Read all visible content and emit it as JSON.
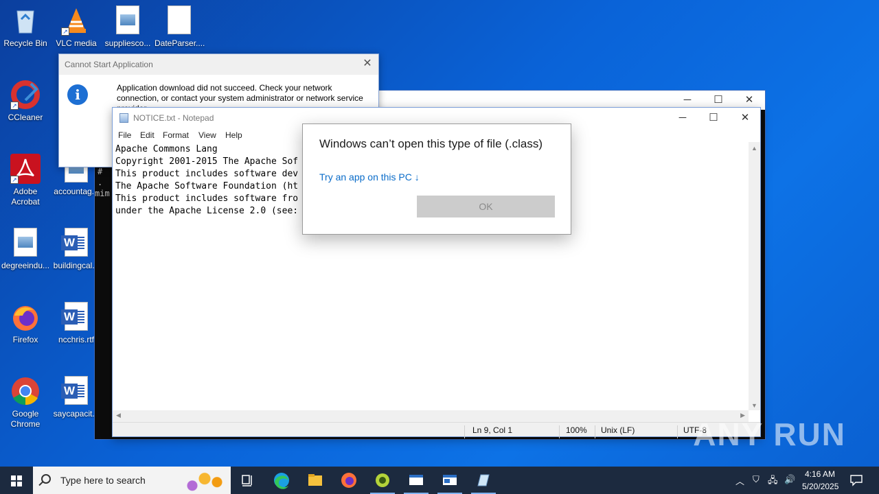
{
  "desktop": {
    "icons": [
      {
        "label": "Recycle Bin",
        "icon": "recycle-bin-icon"
      },
      {
        "label": "VLC media",
        "icon": "vlc-icon"
      },
      {
        "label": "suppliesco...",
        "icon": "image-file-icon"
      },
      {
        "label": "DateParser....",
        "icon": "blank-file-icon"
      },
      {
        "label": "CCleaner",
        "icon": "ccleaner-icon"
      },
      {
        "label": "Adobe Acrobat",
        "icon": "acrobat-icon"
      },
      {
        "label": "accountag...",
        "icon": "image-file-icon"
      },
      {
        "label": "degreeindu...",
        "icon": "image-file-icon"
      },
      {
        "label": "buildingcal...",
        "icon": "word-doc-icon"
      },
      {
        "label": "Firefox",
        "icon": "firefox-icon"
      },
      {
        "label": "ncchris.rtf",
        "icon": "word-doc-icon"
      },
      {
        "label": "Google Chrome",
        "icon": "chrome-icon"
      },
      {
        "label": "saycapacit...",
        "icon": "word-doc-icon"
      }
    ]
  },
  "console": {
    "text_lines": [
      "#",
      ".",
      "mim"
    ]
  },
  "error_dialog": {
    "title": "Cannot Start Application",
    "message": "Application download did not succeed. Check your network connection, or contact your system administrator or network service provider."
  },
  "notepad": {
    "title": "NOTICE.txt - Notepad",
    "menu": [
      "File",
      "Edit",
      "Format",
      "View",
      "Help"
    ],
    "content_lines": [
      "Apache Commons Lang",
      "Copyright 2001-2015 The Apache Sof",
      "",
      "This product includes software dev",
      "The Apache Software Foundation (ht",
      "",
      "This product includes software fro",
      "under the Apache License 2.0 (see: StringUtils.containsWhitespace())"
    ],
    "status": {
      "position": "Ln 9, Col 1",
      "zoom": "100%",
      "line_endings": "Unix (LF)",
      "encoding": "UTF-8"
    }
  },
  "open_with_dialog": {
    "heading": "Windows can’t open this type of file (.class)",
    "link": "Try an app on this PC ↓",
    "ok_label": "OK"
  },
  "watermark": "ANY RUN",
  "taskbar": {
    "search_placeholder": "Type here to search",
    "pinned": [
      "task-view-icon",
      "edge-icon",
      "file-explorer-icon",
      "firefox-icon",
      "app-icon",
      "window-app-icon",
      "window-app-icon",
      "notepad-icon"
    ],
    "time": "4:16 AM",
    "date": "5/20/2025"
  },
  "colors": {
    "desktop_bg": "#0a63d8",
    "taskbar_bg": "#1c2a3f",
    "link": "#0a6cc9",
    "info_icon": "#1d6fd3"
  }
}
